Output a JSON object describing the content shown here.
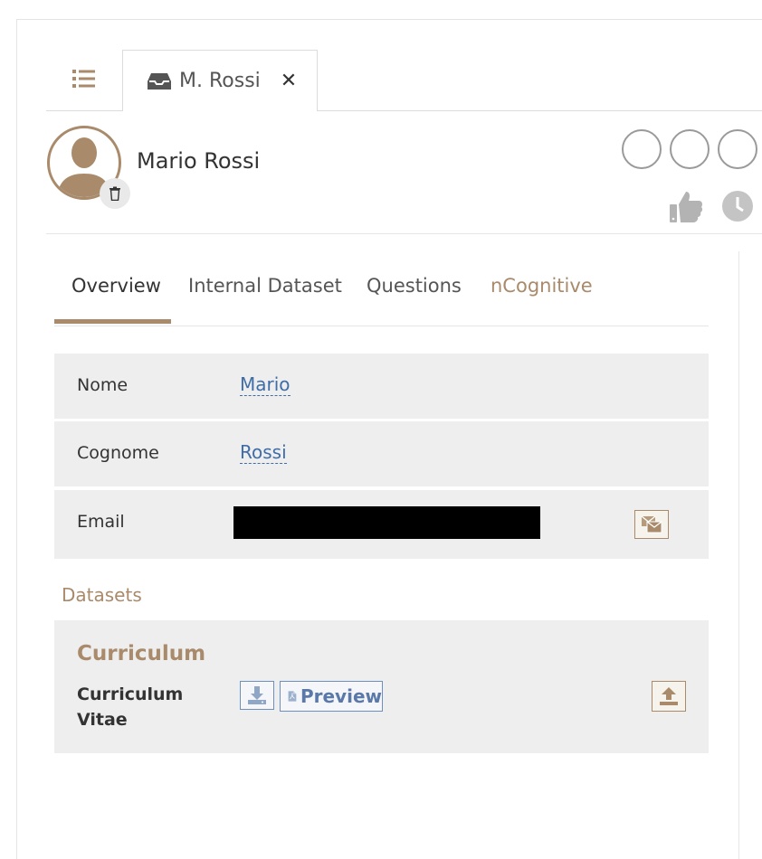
{
  "tabs": {
    "list_icon": "list-icon",
    "profile_tab_label": "M. Rossi",
    "profile_tab_icon": "inbox-icon",
    "close_label": "✕"
  },
  "profile": {
    "name": "Mario Rossi",
    "avatar_icon": "user-silhouette-icon",
    "delete_icon": "trash-icon"
  },
  "nav": {
    "overview": "Overview",
    "internal_dataset": "Internal Dataset",
    "questions": "Questions",
    "ncognitive": "nCognitive"
  },
  "fields": [
    {
      "label": "Nome",
      "value": "Mario"
    },
    {
      "label": "Cognome",
      "value": "Rossi"
    },
    {
      "label": "Email",
      "value": ""
    }
  ],
  "datasets": {
    "section_title": "Datasets",
    "group_title": "Curriculum",
    "item_label": "Curriculum Vitae",
    "preview_label": "Preview"
  },
  "colors": {
    "accent": "#a98a6a",
    "link": "#3f6da8",
    "row_bg": "#eeeeee"
  }
}
